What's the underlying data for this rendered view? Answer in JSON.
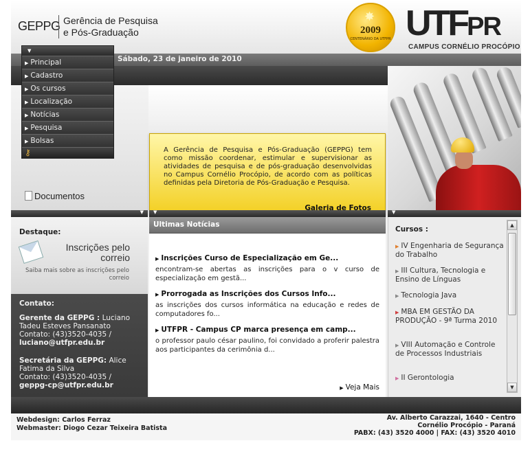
{
  "header": {
    "short_name": "GEPPG",
    "title_line1": "Gerência de Pesquisa",
    "title_line2": "e Pós-Graduação",
    "seal_year": "2009",
    "seal_text": "CENTENÁRIO DA UTFPR",
    "brand": "UTF",
    "brand_suffix": "PR",
    "campus": "CAMPUS CORNÉLIO PROCÓPIO"
  },
  "date": "Sábado, 23 de janeiro de 2010",
  "menu": {
    "items": [
      "Principal",
      "Cadastro",
      "Os cursos",
      "Localização",
      "Notícias",
      "Pesquisa",
      "Bolsas"
    ]
  },
  "documentos_label": "Documentos",
  "intro": {
    "text": "A Gerência de Pesquisa e Pós-Graduação (GEPPG) tem como missão coordenar, estimular e supervisionar as atividades de pesquisa e de pós-graduação desenvolvidas no Campus Cornélio Procópio, de acordo com as políticas definidas pela Diretoria de Pós-Graduação e Pesquisa.",
    "galeria": "Galeria de Fotos"
  },
  "destaque": {
    "heading": "Destaque:",
    "title": "Inscrições pelo correio",
    "link": "Saiba mais sobre as inscrições pelo correio"
  },
  "contato": {
    "heading": "Contato:",
    "gerente_label": "Gerente da GEPPG :",
    "gerente_name": "Luciano Tadeu Esteves Pansanato",
    "gerente_phone": "Contato: (43)3520-4035 /",
    "gerente_email": "luciano@utfpr.edu.br",
    "secretaria_label": "Secretária da GEPPG:",
    "secretaria_name": "Alice Fatima da Silva",
    "secretaria_phone": "Contato: (43)3520-4035 /",
    "secretaria_email": "geppg-cp@utfpr.edu.br"
  },
  "news": {
    "heading": "Ultimas Notícias",
    "items": [
      {
        "title": "Inscrições Curso de Especialização em Ge...",
        "desc": " encontram-se abertas as inscrições para o v curso de especialização em gestã..."
      },
      {
        "title": "Prorrogada as Inscrições dos Cursos Info...",
        "desc": "  as inscrições dos cursos informática na educação e redes de computadores fo..."
      },
      {
        "title": "UTFPR - Campus CP marca presença em camp...",
        "desc": "o professor paulo césar paulino, foi convidado a proferir palestra aos participantes da cerimônia d..."
      }
    ],
    "more": "Veja Mais"
  },
  "cursos": {
    "heading": "Cursos :",
    "items": [
      "IV Engenharia de Segurança do Trabalho",
      "III Cultura, Tecnologia e Ensino de Línguas",
      "Tecnologia Java",
      "MBA EM GESTÃO DA PRODUÇÃO - 9ª Turma 2010",
      "VIII Automação e Controle de Processos Industriais",
      "II Gerontologia"
    ]
  },
  "footer": {
    "webdesign": "Webdesign: Carlos Ferraz",
    "webmaster": "Webmaster: Diogo Cezar Teixeira Batista",
    "address1": "Av. Alberto Carazzai, 1640 - Centro",
    "address2": "Cornélio Procópio - Paraná",
    "phones": "PABX: (43) 3520 4000 | FAX: (43) 3520 4010"
  }
}
